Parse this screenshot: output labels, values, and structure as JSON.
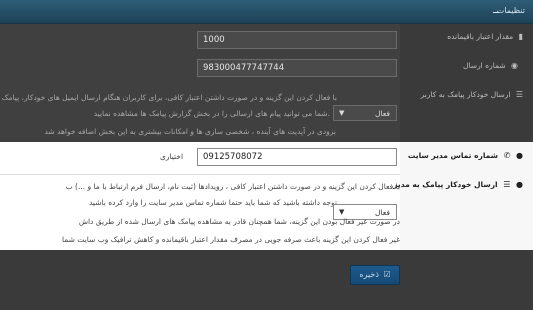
{
  "header": {
    "title": "تنظیمات"
  },
  "sidebar": {
    "credit_label": "مقدار اعتبار باقیمانده",
    "sender_number_label": "شماره ارسال",
    "auto_sms_user_label": "ارسال خودکار پیامک به کاربر",
    "admin_contact_label": "شماره تماس مدیر سایت",
    "auto_sms_admin_label": "ارسال خودکار پیامک به مدیر"
  },
  "fields": {
    "credit_value": "1000",
    "sender_number_value": "983000477747744",
    "admin_phone_value": "09125708072",
    "admin_phone_label": "اختیاری"
  },
  "selects": {
    "user_sms_value": "فعال",
    "admin_sms_value": "فعال"
  },
  "descriptions": {
    "user_line1": "با فعال کردن این گزینه و در صورت داشتن اعتبار کافی، برای کاربران هنگام ارسال ایمیل های خودکار، پیامک",
    "user_line2": "شما می توانید پیام های ارسالی را در بخش گزارش پیامک ها مشاهده نمایید.",
    "user_line3": "بزودی در آپدیت های آینده ، شخصی سازی ها و امکانات بیشتری به این بخش اضافه خواهد شد",
    "admin_line1": "با فعال کردن این گزینه و در صورت داشتن اعتبار کافی ، رویدادها (ثبت نام، ارسال فرم ارتباط با ما و ...) ب",
    "admin_line2": "توجه داشته باشید که شما باید حتما شماره تماس مدیر سایت را وارد کرده باشید",
    "admin_line3": "در صورت غیر فعال بودن این گزینه، شما همچنان قادر به مشاهده پیامک های ارسال شده از طریق داش",
    "admin_line4": "غیر فعال کردن این گزینه باعث صرفه جویی در مصرف مقدار اعتبار باقیمانده و کاهش ترافیک وب سایت شما"
  },
  "actions": {
    "save_label": "ذخیره"
  },
  "icons": {
    "credit": "signal-bars-icon",
    "sender": "circle-arrow-icon",
    "user_sms": "bars-icon",
    "phone": "phone-icon",
    "user": "user-icon",
    "save": "check-square-icon"
  }
}
